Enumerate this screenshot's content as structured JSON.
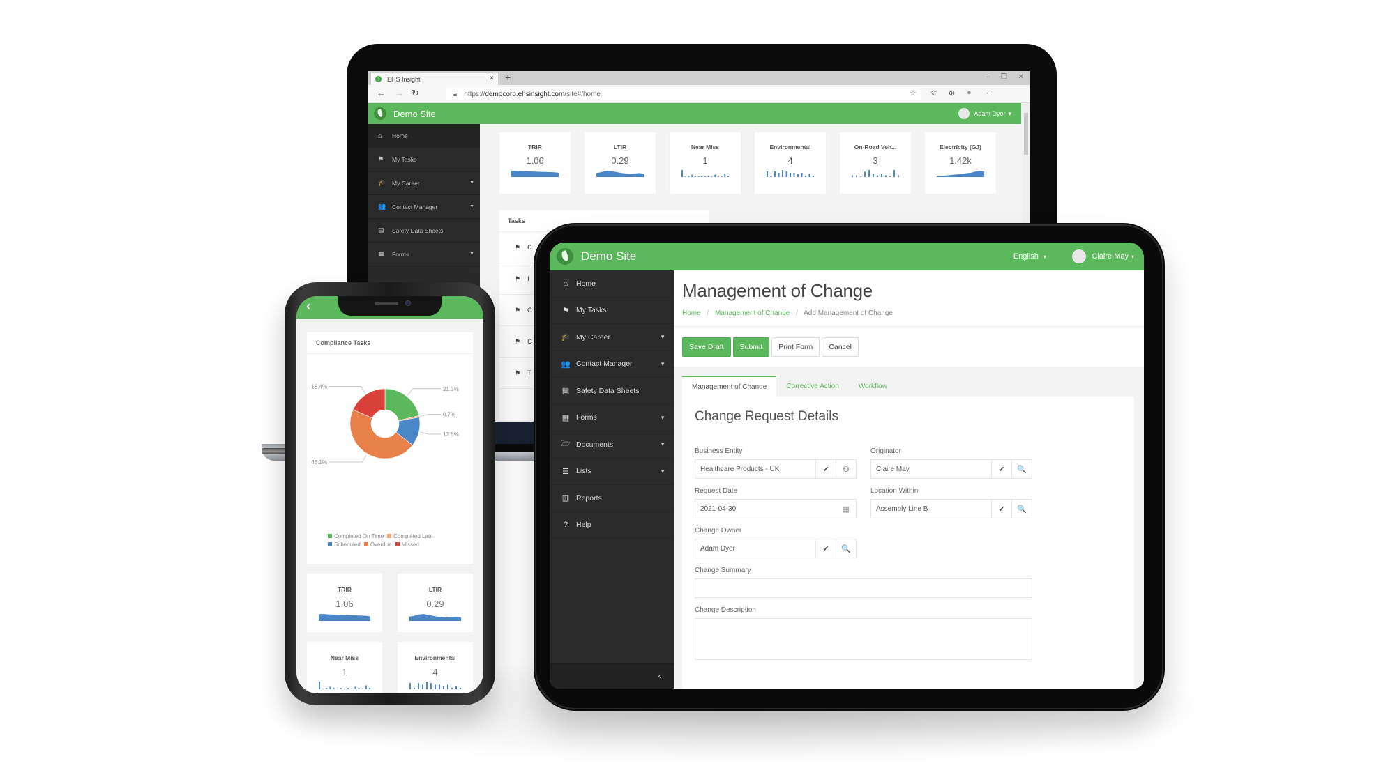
{
  "laptop": {
    "browser": {
      "tab_title": "EHS Insight",
      "tab_close": "×",
      "new_tab": "+",
      "url_scheme": "https://",
      "url_host": "democorp.ehsinsight.com",
      "url_path": "/site#/home",
      "window_controls": [
        "–",
        "❐",
        "✕"
      ],
      "nav_icons": [
        "←",
        "→",
        "↻"
      ],
      "toolbar_icons": [
        "☆",
        "✩",
        "⊕",
        "●",
        "⋯"
      ]
    },
    "header": {
      "site_name": "Demo Site",
      "user_name": "Adam Dyer",
      "user_caret": "▾"
    },
    "sidebar": {
      "items": [
        {
          "label": "Home",
          "icon": "home-icon",
          "glyph": "⌂",
          "has_caret": false
        },
        {
          "label": "My Tasks",
          "icon": "flag-icon",
          "glyph": "⚑",
          "has_caret": false
        },
        {
          "label": "My Career",
          "icon": "graduation-cap-icon",
          "glyph": "🎓",
          "has_caret": true
        },
        {
          "label": "Contact Manager",
          "icon": "users-icon",
          "glyph": "👥",
          "has_caret": true
        },
        {
          "label": "Safety Data Sheets",
          "icon": "briefcase-icon",
          "glyph": "▤",
          "has_caret": false
        },
        {
          "label": "Forms",
          "icon": "form-icon",
          "glyph": "▦",
          "has_caret": true
        }
      ]
    },
    "kpis": [
      {
        "label": "TRIR",
        "value": "1.06",
        "spark": "area",
        "data": [
          8,
          8,
          7.6,
          7.4,
          7.2,
          7,
          6.8,
          6.6,
          6.4,
          6.2,
          6,
          5.4
        ]
      },
      {
        "label": "LTIR",
        "value": "0.29",
        "spark": "area",
        "data": [
          5,
          6,
          7.5,
          8,
          7,
          6,
          5,
          4.5,
          4,
          4.6,
          5,
          4
        ]
      },
      {
        "label": "Near Miss",
        "value": "1",
        "spark": "bars",
        "data": [
          6,
          0,
          1,
          2,
          1,
          0,
          1,
          0,
          1,
          0,
          2,
          1,
          0,
          3,
          1
        ]
      },
      {
        "label": "Environmental",
        "value": "4",
        "spark": "bars",
        "data": [
          4,
          1,
          4,
          3,
          5,
          4,
          3,
          3,
          2,
          3,
          1,
          2,
          1
        ]
      },
      {
        "label": "On-Road Veh...",
        "value": "3",
        "spark": "bars",
        "data": [
          1,
          1,
          0,
          3,
          4,
          2,
          1,
          2,
          1,
          0,
          4,
          1
        ]
      },
      {
        "label": "Electricity (GJ)",
        "value": "1.42k",
        "spark": "area",
        "data": [
          1,
          1.5,
          2,
          2.5,
          3,
          3.5,
          4,
          5,
          5.5,
          7,
          8,
          7
        ]
      }
    ],
    "tasks": {
      "title": "Tasks",
      "rows": [
        "C",
        "I",
        "C",
        "C",
        "T"
      ]
    },
    "close_icon": "×"
  },
  "tablet": {
    "header": {
      "site_name": "Demo Site",
      "language": "English",
      "user_name": "Claire May",
      "caret": "▾"
    },
    "sidebar": {
      "items": [
        {
          "label": "Home",
          "icon": "home-icon",
          "glyph": "⌂",
          "has_caret": false
        },
        {
          "label": "My Tasks",
          "icon": "flag-icon",
          "glyph": "⚑",
          "has_caret": false
        },
        {
          "label": "My Career",
          "icon": "graduation-cap-icon",
          "glyph": "🎓",
          "has_caret": true
        },
        {
          "label": "Contact Manager",
          "icon": "users-icon",
          "glyph": "👥",
          "has_caret": true
        },
        {
          "label": "Safety Data Sheets",
          "icon": "briefcase-icon",
          "glyph": "▤",
          "has_caret": false
        },
        {
          "label": "Forms",
          "icon": "form-icon",
          "glyph": "▦",
          "has_caret": true
        },
        {
          "label": "Documents",
          "icon": "folder-icon",
          "glyph": "🗁",
          "has_caret": true
        },
        {
          "label": "Lists",
          "icon": "list-icon",
          "glyph": "☰",
          "has_caret": true
        },
        {
          "label": "Reports",
          "icon": "bar-chart-icon",
          "glyph": "▥",
          "has_caret": false
        },
        {
          "label": "Help",
          "icon": "help-icon",
          "glyph": "?",
          "has_caret": false
        }
      ],
      "collapse_glyph": "‹"
    },
    "page": {
      "title": "Management of Change",
      "breadcrumb": [
        "Home",
        "Management of Change",
        "Add Management of Change"
      ],
      "breadcrumb_sep": "/",
      "actions": {
        "save_draft": "Save Draft",
        "submit": "Submit",
        "print_form": "Print Form",
        "cancel": "Cancel"
      },
      "tabs": [
        "Management of Change",
        "Corrective Action",
        "Workflow"
      ],
      "active_tab": 0,
      "form": {
        "section_title": "Change Request Details",
        "fields": {
          "business_entity": {
            "label": "Business Entity",
            "value": "Healthcare Products - UK"
          },
          "originator": {
            "label": "Originator",
            "value": "Claire May"
          },
          "request_date": {
            "label": "Request Date",
            "value": "2021-04-30"
          },
          "location_within": {
            "label": "Location Within",
            "value": "Assembly Line B"
          },
          "change_owner": {
            "label": "Change Owner",
            "value": "Adam Dyer"
          },
          "change_summary": {
            "label": "Change Summary",
            "value": ""
          },
          "change_description": {
            "label": "Change Description",
            "value": ""
          }
        },
        "icons": {
          "check": "✔",
          "search": "🔍",
          "hierarchy": "⚇",
          "calendar": "▦"
        }
      }
    }
  },
  "phone": {
    "back_glyph": "‹",
    "compliance_card": {
      "title": "Compliance Tasks"
    },
    "kpis": [
      {
        "label": "TRIR",
        "value": "1.06",
        "spark": "area",
        "data": [
          8,
          8,
          7.6,
          7.4,
          7.2,
          7,
          6.8,
          6.6,
          6.4,
          6.2,
          6,
          5.4
        ]
      },
      {
        "label": "LTIR",
        "value": "0.29",
        "spark": "area",
        "data": [
          5,
          6,
          7.5,
          8,
          7,
          6,
          5,
          4.5,
          4,
          4.6,
          5,
          4
        ]
      },
      {
        "label": "Near Miss",
        "value": "1",
        "spark": "bars",
        "data": [
          6,
          0,
          1,
          2,
          1,
          0,
          1,
          0,
          1,
          0,
          2,
          1,
          0,
          3,
          1
        ]
      },
      {
        "label": "Environmental",
        "value": "4",
        "spark": "bars",
        "data": [
          4,
          1,
          4,
          3,
          5,
          4,
          3,
          3,
          2,
          3,
          1,
          2,
          1
        ]
      }
    ]
  },
  "colors": {
    "brand_green": "#5cb85c",
    "sidebar_dark": "#2b2b2b",
    "spark_blue": "#4a86c8"
  },
  "chart_data": {
    "type": "pie",
    "title": "Compliance Tasks",
    "donut": true,
    "categories": [
      "Completed On Time",
      "Completed Late",
      "Scheduled",
      "Overdue",
      "Missed"
    ],
    "values": [
      21.3,
      0.7,
      13.5,
      46.1,
      18.4
    ],
    "labels": [
      "21.3%",
      "0.7%",
      "13.5%",
      "46.1%",
      "18.4%"
    ],
    "colors": [
      "#5cb85c",
      "#f0a87a",
      "#4a86c8",
      "#e8804a",
      "#d9403a"
    ],
    "legend": "bottom",
    "unit": "%"
  }
}
